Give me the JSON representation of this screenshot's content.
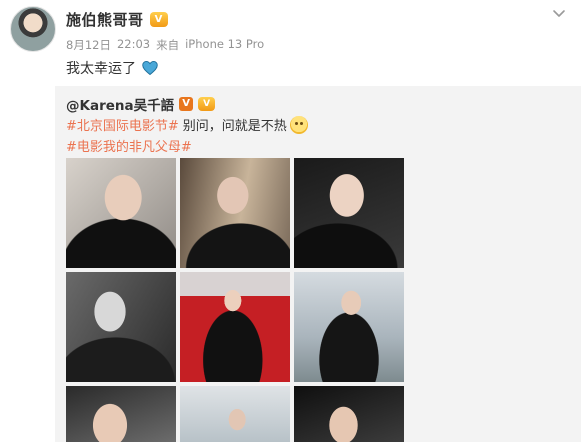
{
  "post": {
    "author": "施伯熊哥哥",
    "vip_badge": "V",
    "date": "8月12日",
    "time": "22:03",
    "source_prefix": "来自",
    "source": "iPhone 13 Pro",
    "text": "我太幸运了",
    "icons": {
      "chevron": "chevron-down-icon",
      "heart": "blue-heart-emoji"
    }
  },
  "repost": {
    "author": "@Karena吴千語",
    "verified_badge": "V",
    "vip_badge": "V",
    "hashtag1": "#北京国际电影节#",
    "text": "别问，问就是不热",
    "hashtag2": "#电影我的非凡父母#",
    "photos": [
      "photo-1",
      "photo-2",
      "photo-3",
      "photo-4",
      "photo-5",
      "photo-6",
      "photo-7",
      "photo-8",
      "photo-9"
    ]
  },
  "colors": {
    "hashtag": "#eb7350",
    "repost_bg": "#f3f3f3",
    "meta": "#939393",
    "heart": "#4aa8d8"
  }
}
